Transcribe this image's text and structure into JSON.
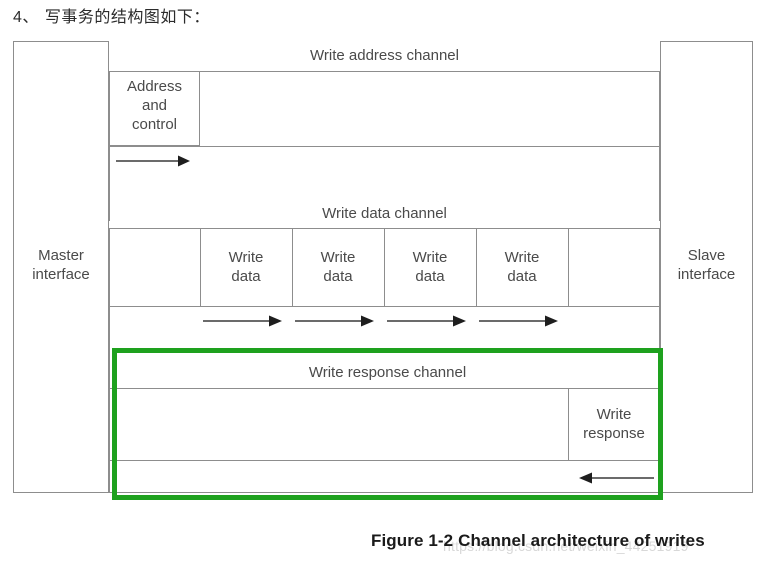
{
  "document": {
    "heading_number": "4、",
    "heading_text": "写事务的结构图如下："
  },
  "figure": {
    "caption": "Figure 1-2 Channel architecture of writes",
    "watermark": "https://blog.csdn.net/weixin_44251919",
    "master_interface": {
      "line1": "Master",
      "line2": "interface"
    },
    "slave_interface": {
      "line1": "Slave",
      "line2": "interface"
    },
    "channels": [
      {
        "id": "write-address-channel",
        "title": "Write address channel",
        "cells": [
          {
            "line1": "Address",
            "line2": "and",
            "line3": "control"
          }
        ],
        "arrows": [
          {
            "direction": "right"
          }
        ]
      },
      {
        "id": "write-data-channel",
        "title": "Write data channel",
        "cells": [
          {
            "line1": "Write",
            "line2": "data"
          },
          {
            "line1": "Write",
            "line2": "data"
          },
          {
            "line1": "Write",
            "line2": "data"
          },
          {
            "line1": "Write",
            "line2": "data"
          }
        ],
        "arrows": [
          {
            "direction": "right"
          },
          {
            "direction": "right"
          },
          {
            "direction": "right"
          },
          {
            "direction": "right"
          }
        ]
      },
      {
        "id": "write-response-channel",
        "title": "Write response channel",
        "cells": [
          {
            "line1": "Write",
            "line2": "response"
          }
        ],
        "arrows": [
          {
            "direction": "left"
          }
        ],
        "highlighted": true
      }
    ],
    "colors": {
      "highlight": "#1ea11e",
      "stroke": "#8d8d8d",
      "text": "#4a4a4a",
      "caption": "#1a1a1a"
    }
  }
}
